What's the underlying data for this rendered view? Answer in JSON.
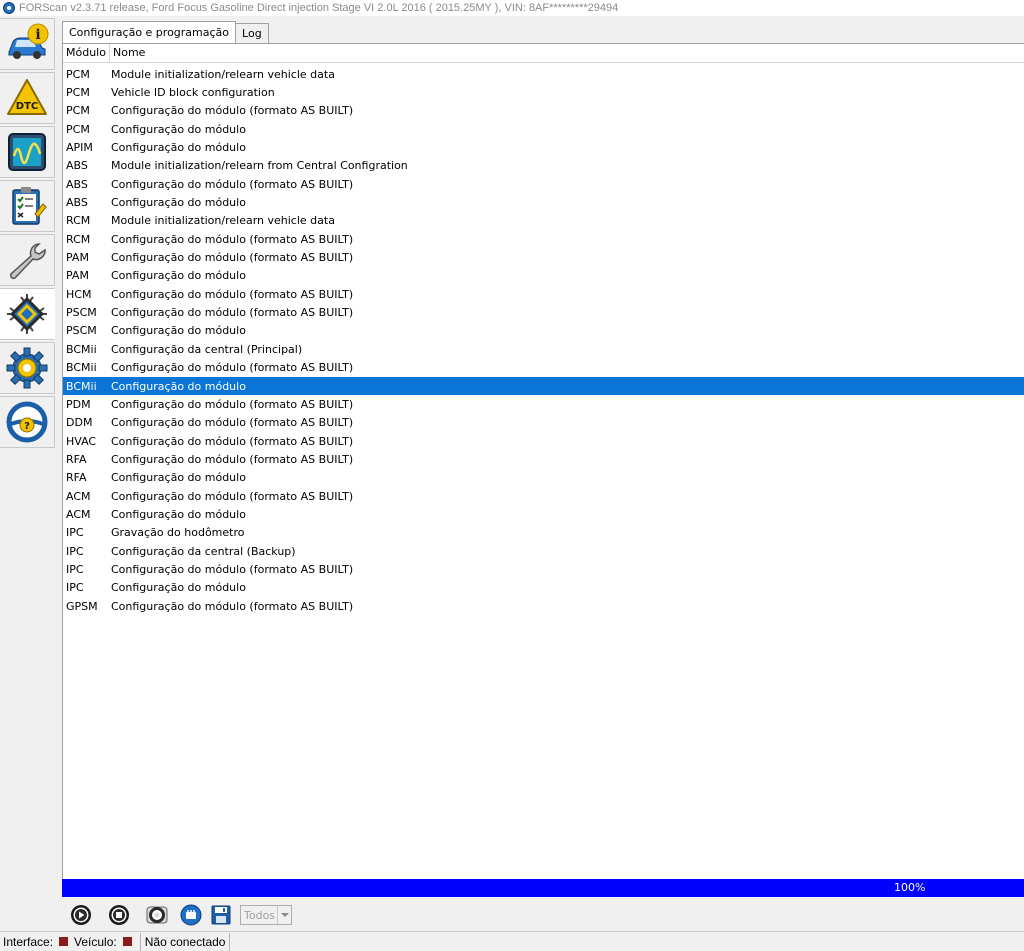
{
  "window": {
    "title": "FORScan v2.3.71 release, Ford Focus Gasoline Direct injection Stage VI 2.0L 2016 ( 2015.25MY ), VIN: 8AF*********29494"
  },
  "sidebar": {
    "items": [
      {
        "name": "vehicle-info",
        "icon": "car-info-icon"
      },
      {
        "name": "dtc",
        "icon": "dtc-warning-icon"
      },
      {
        "name": "oscilloscope",
        "icon": "oscilloscope-icon"
      },
      {
        "name": "tests",
        "icon": "checklist-icon"
      },
      {
        "name": "service",
        "icon": "wrench-icon"
      },
      {
        "name": "configuration",
        "icon": "chip-icon",
        "active": true
      },
      {
        "name": "settings",
        "icon": "gear-icon"
      },
      {
        "name": "help",
        "icon": "steering-help-icon"
      }
    ]
  },
  "tabs": [
    {
      "label": "Configuração e programação",
      "active": true
    },
    {
      "label": "Log",
      "active": false
    }
  ],
  "table": {
    "headers": {
      "module": "Módulo",
      "name": "Nome"
    },
    "rows": [
      {
        "module": "PCM",
        "name": "Module initialization/relearn vehicle data"
      },
      {
        "module": "PCM",
        "name": "Vehicle ID block configuration"
      },
      {
        "module": "PCM",
        "name": "Configuração do módulo (formato AS BUILT)"
      },
      {
        "module": "PCM",
        "name": "Configuração do módulo"
      },
      {
        "module": "APIM",
        "name": "Configuração do módulo"
      },
      {
        "module": "ABS",
        "name": "Module initialization/relearn from Central Configration"
      },
      {
        "module": "ABS",
        "name": "Configuração do módulo (formato AS BUILT)"
      },
      {
        "module": "ABS",
        "name": "Configuração do módulo"
      },
      {
        "module": "RCM",
        "name": "Module initialization/relearn vehicle data"
      },
      {
        "module": "RCM",
        "name": "Configuração do módulo (formato AS BUILT)"
      },
      {
        "module": "PAM",
        "name": "Configuração do módulo (formato AS BUILT)"
      },
      {
        "module": "PAM",
        "name": "Configuração do módulo"
      },
      {
        "module": "HCM",
        "name": "Configuração do módulo (formato AS BUILT)"
      },
      {
        "module": "PSCM",
        "name": "Configuração do módulo (formato AS BUILT)"
      },
      {
        "module": "PSCM",
        "name": "Configuração do módulo"
      },
      {
        "module": "BCMii",
        "name": "Configuração da central (Principal)"
      },
      {
        "module": "BCMii",
        "name": "Configuração do módulo (formato AS BUILT)"
      },
      {
        "module": "BCMii",
        "name": "Configuração do módulo",
        "selected": true
      },
      {
        "module": "PDM",
        "name": "Configuração do módulo (formato AS BUILT)"
      },
      {
        "module": "DDM",
        "name": "Configuração do módulo (formato AS BUILT)"
      },
      {
        "module": "HVAC",
        "name": "Configuração do módulo (formato AS BUILT)"
      },
      {
        "module": "RFA",
        "name": "Configuração do módulo (formato AS BUILT)"
      },
      {
        "module": "RFA",
        "name": "Configuração do módulo"
      },
      {
        "module": "ACM",
        "name": "Configuração do módulo (formato AS BUILT)"
      },
      {
        "module": "ACM",
        "name": "Configuração do módulo"
      },
      {
        "module": "IPC",
        "name": "Gravação do hodômetro"
      },
      {
        "module": "IPC",
        "name": "Configuração da central (Backup)"
      },
      {
        "module": "IPC",
        "name": "Configuração do módulo (formato AS BUILT)"
      },
      {
        "module": "IPC",
        "name": "Configuração do módulo"
      },
      {
        "module": "GPSM",
        "name": "Configuração do módulo (formato AS BUILT)"
      }
    ]
  },
  "progress": {
    "value": 100,
    "label": "100%",
    "color": "#0000ff"
  },
  "toolbar": {
    "buttons": [
      "play-icon",
      "stop-icon",
      "lifebuoy-icon",
      "module-icon",
      "save-icon"
    ],
    "filter": {
      "value": "Todos"
    }
  },
  "statusbar": {
    "interface_label": "Interface:",
    "vehicle_label": "Veículo:",
    "connection_status": "Não conectado",
    "status_color": "#8b1a1a"
  },
  "colors": {
    "selection": "#0a74d7",
    "accent": "#1f6fc5"
  }
}
